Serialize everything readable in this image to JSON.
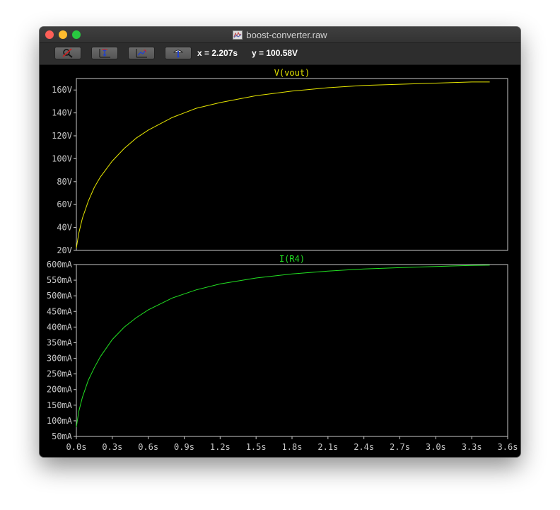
{
  "window": {
    "title": "boost-converter.raw"
  },
  "toolbar": {
    "buttons": [
      {
        "icon": "zoom-cancel-icon"
      },
      {
        "icon": "autoscale-icon"
      },
      {
        "icon": "zoom-fit-icon"
      },
      {
        "icon": "probe-icon"
      }
    ],
    "x_readout": "x = 2.207s",
    "y_readout": "y = 100.58V"
  },
  "colors": {
    "vout": "#e6e600",
    "ir4": "#22e022",
    "axis": "#c8c8c8",
    "frame": "#c8c8c8"
  },
  "chart_data": [
    {
      "type": "line",
      "title": "V(vout)",
      "xlim": [
        0,
        3.6
      ],
      "ylim": [
        20,
        170
      ],
      "yticks": [
        20,
        40,
        60,
        80,
        100,
        120,
        140,
        160
      ],
      "ytick_labels": [
        "20V",
        "40V",
        "60V",
        "80V",
        "100V",
        "120V",
        "140V",
        "160V"
      ],
      "series": [
        {
          "name": "V(vout)",
          "x": [
            0,
            0.02,
            0.05,
            0.1,
            0.15,
            0.2,
            0.3,
            0.4,
            0.5,
            0.6,
            0.8,
            1.0,
            1.2,
            1.5,
            1.8,
            2.1,
            2.4,
            2.7,
            3.0,
            3.3,
            3.45
          ],
          "y": [
            22,
            35,
            48,
            63,
            75,
            84,
            98,
            109,
            118,
            125,
            136,
            144,
            149,
            155,
            159,
            162,
            164,
            165,
            166,
            167,
            167
          ]
        }
      ]
    },
    {
      "type": "line",
      "title": "I(R4)",
      "xlim": [
        0,
        3.6
      ],
      "ylim": [
        50,
        600
      ],
      "yticks": [
        50,
        100,
        150,
        200,
        250,
        300,
        350,
        400,
        450,
        500,
        550,
        600
      ],
      "ytick_labels": [
        "50mA",
        "100mA",
        "150mA",
        "200mA",
        "250mA",
        "300mA",
        "350mA",
        "400mA",
        "450mA",
        "500mA",
        "550mA",
        "600mA"
      ],
      "xticks": [
        0,
        0.3,
        0.6,
        0.9,
        1.2,
        1.5,
        1.8,
        2.1,
        2.4,
        2.7,
        3.0,
        3.3,
        3.6
      ],
      "xtick_labels": [
        "0.0s",
        "0.3s",
        "0.6s",
        "0.9s",
        "1.2s",
        "1.5s",
        "1.8s",
        "2.1s",
        "2.4s",
        "2.7s",
        "3.0s",
        "3.3s",
        "3.6s"
      ],
      "series": [
        {
          "name": "I(R4)",
          "x": [
            0,
            0.02,
            0.05,
            0.1,
            0.15,
            0.2,
            0.3,
            0.4,
            0.5,
            0.6,
            0.8,
            1.0,
            1.2,
            1.5,
            1.8,
            2.1,
            2.4,
            2.7,
            3.0,
            3.3,
            3.45
          ],
          "y": [
            80,
            130,
            175,
            230,
            270,
            305,
            360,
            400,
            430,
            455,
            493,
            519,
            538,
            557,
            570,
            579,
            586,
            590,
            594,
            597,
            598
          ]
        }
      ]
    }
  ]
}
